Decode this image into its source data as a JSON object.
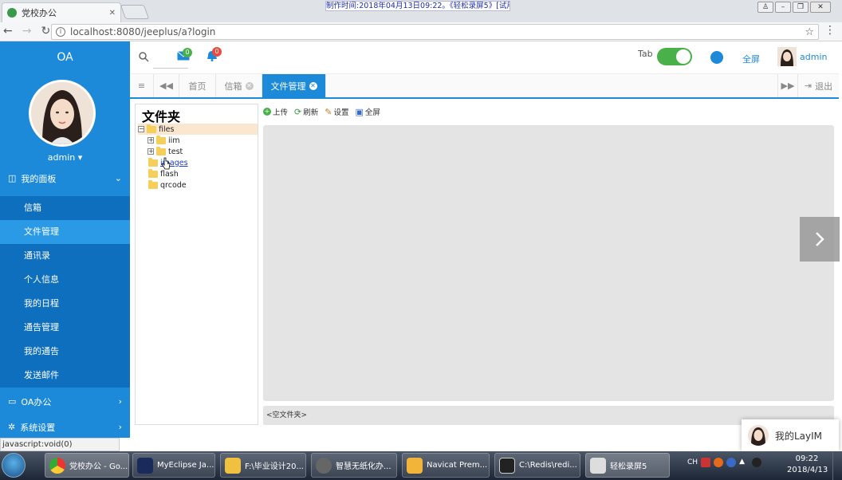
{
  "browser": {
    "tab_title": "党校办公",
    "recording_banner": "制作时间:2018年04月13日09:22。《轻松录屏5》[试用版]",
    "url": "localhost:8080/jeeplus/a?login",
    "status_url": "javascript:void(0)"
  },
  "sidebar": {
    "brand": "OA",
    "username": "admin",
    "group_panel": "我的面板",
    "items": [
      {
        "label": "信箱"
      },
      {
        "label": "文件管理"
      },
      {
        "label": "通讯录"
      },
      {
        "label": "个人信息"
      },
      {
        "label": "我的日程"
      },
      {
        "label": "通告管理"
      },
      {
        "label": "我的通告"
      },
      {
        "label": "发送邮件"
      }
    ],
    "group_oa": "OA办公",
    "group_settings": "系统设置"
  },
  "header": {
    "mail_count": "0",
    "notice_count": "0",
    "tab_label": "Tab",
    "fullscreen": "全屏",
    "admin": "admin"
  },
  "tabs": {
    "home": "首页",
    "mail": "信箱",
    "files": "文件管理",
    "logout": "退出"
  },
  "tree": {
    "title": "文件夹",
    "root": "files",
    "children": [
      "iim",
      "test",
      "images",
      "flash",
      "qrcode"
    ]
  },
  "toolbar": {
    "upload": "上传",
    "refresh": "刷新",
    "settings": "设置",
    "fullscreen": "全屏"
  },
  "status": {
    "empty_folder": "<空文件夹>"
  },
  "laylm": "我的LayIM",
  "taskbar": {
    "tasks": [
      "党校办公 - Go...",
      "MyEclipse Ja...",
      "F:\\毕业设计20...",
      "智慧无纸化办...",
      "Navicat Prem...",
      "C:\\Redis\\redi...",
      "轻松录屏5"
    ],
    "tray_lang": "CH",
    "time": "09:22",
    "date": "2018/4/13"
  }
}
